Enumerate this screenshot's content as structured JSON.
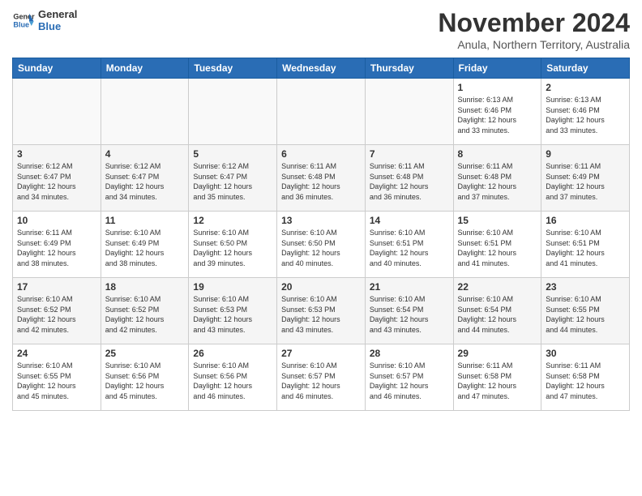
{
  "logo": {
    "line1": "General",
    "line2": "Blue"
  },
  "title": "November 2024",
  "subtitle": "Anula, Northern Territory, Australia",
  "days_header": [
    "Sunday",
    "Monday",
    "Tuesday",
    "Wednesday",
    "Thursday",
    "Friday",
    "Saturday"
  ],
  "weeks": [
    [
      {
        "day": "",
        "info": ""
      },
      {
        "day": "",
        "info": ""
      },
      {
        "day": "",
        "info": ""
      },
      {
        "day": "",
        "info": ""
      },
      {
        "day": "",
        "info": ""
      },
      {
        "day": "1",
        "info": "Sunrise: 6:13 AM\nSunset: 6:46 PM\nDaylight: 12 hours\nand 33 minutes."
      },
      {
        "day": "2",
        "info": "Sunrise: 6:13 AM\nSunset: 6:46 PM\nDaylight: 12 hours\nand 33 minutes."
      }
    ],
    [
      {
        "day": "3",
        "info": "Sunrise: 6:12 AM\nSunset: 6:47 PM\nDaylight: 12 hours\nand 34 minutes."
      },
      {
        "day": "4",
        "info": "Sunrise: 6:12 AM\nSunset: 6:47 PM\nDaylight: 12 hours\nand 34 minutes."
      },
      {
        "day": "5",
        "info": "Sunrise: 6:12 AM\nSunset: 6:47 PM\nDaylight: 12 hours\nand 35 minutes."
      },
      {
        "day": "6",
        "info": "Sunrise: 6:11 AM\nSunset: 6:48 PM\nDaylight: 12 hours\nand 36 minutes."
      },
      {
        "day": "7",
        "info": "Sunrise: 6:11 AM\nSunset: 6:48 PM\nDaylight: 12 hours\nand 36 minutes."
      },
      {
        "day": "8",
        "info": "Sunrise: 6:11 AM\nSunset: 6:48 PM\nDaylight: 12 hours\nand 37 minutes."
      },
      {
        "day": "9",
        "info": "Sunrise: 6:11 AM\nSunset: 6:49 PM\nDaylight: 12 hours\nand 37 minutes."
      }
    ],
    [
      {
        "day": "10",
        "info": "Sunrise: 6:11 AM\nSunset: 6:49 PM\nDaylight: 12 hours\nand 38 minutes."
      },
      {
        "day": "11",
        "info": "Sunrise: 6:10 AM\nSunset: 6:49 PM\nDaylight: 12 hours\nand 38 minutes."
      },
      {
        "day": "12",
        "info": "Sunrise: 6:10 AM\nSunset: 6:50 PM\nDaylight: 12 hours\nand 39 minutes."
      },
      {
        "day": "13",
        "info": "Sunrise: 6:10 AM\nSunset: 6:50 PM\nDaylight: 12 hours\nand 40 minutes."
      },
      {
        "day": "14",
        "info": "Sunrise: 6:10 AM\nSunset: 6:51 PM\nDaylight: 12 hours\nand 40 minutes."
      },
      {
        "day": "15",
        "info": "Sunrise: 6:10 AM\nSunset: 6:51 PM\nDaylight: 12 hours\nand 41 minutes."
      },
      {
        "day": "16",
        "info": "Sunrise: 6:10 AM\nSunset: 6:51 PM\nDaylight: 12 hours\nand 41 minutes."
      }
    ],
    [
      {
        "day": "17",
        "info": "Sunrise: 6:10 AM\nSunset: 6:52 PM\nDaylight: 12 hours\nand 42 minutes."
      },
      {
        "day": "18",
        "info": "Sunrise: 6:10 AM\nSunset: 6:52 PM\nDaylight: 12 hours\nand 42 minutes."
      },
      {
        "day": "19",
        "info": "Sunrise: 6:10 AM\nSunset: 6:53 PM\nDaylight: 12 hours\nand 43 minutes."
      },
      {
        "day": "20",
        "info": "Sunrise: 6:10 AM\nSunset: 6:53 PM\nDaylight: 12 hours\nand 43 minutes."
      },
      {
        "day": "21",
        "info": "Sunrise: 6:10 AM\nSunset: 6:54 PM\nDaylight: 12 hours\nand 43 minutes."
      },
      {
        "day": "22",
        "info": "Sunrise: 6:10 AM\nSunset: 6:54 PM\nDaylight: 12 hours\nand 44 minutes."
      },
      {
        "day": "23",
        "info": "Sunrise: 6:10 AM\nSunset: 6:55 PM\nDaylight: 12 hours\nand 44 minutes."
      }
    ],
    [
      {
        "day": "24",
        "info": "Sunrise: 6:10 AM\nSunset: 6:55 PM\nDaylight: 12 hours\nand 45 minutes."
      },
      {
        "day": "25",
        "info": "Sunrise: 6:10 AM\nSunset: 6:56 PM\nDaylight: 12 hours\nand 45 minutes."
      },
      {
        "day": "26",
        "info": "Sunrise: 6:10 AM\nSunset: 6:56 PM\nDaylight: 12 hours\nand 46 minutes."
      },
      {
        "day": "27",
        "info": "Sunrise: 6:10 AM\nSunset: 6:57 PM\nDaylight: 12 hours\nand 46 minutes."
      },
      {
        "day": "28",
        "info": "Sunrise: 6:10 AM\nSunset: 6:57 PM\nDaylight: 12 hours\nand 46 minutes."
      },
      {
        "day": "29",
        "info": "Sunrise: 6:11 AM\nSunset: 6:58 PM\nDaylight: 12 hours\nand 47 minutes."
      },
      {
        "day": "30",
        "info": "Sunrise: 6:11 AM\nSunset: 6:58 PM\nDaylight: 12 hours\nand 47 minutes."
      }
    ]
  ]
}
